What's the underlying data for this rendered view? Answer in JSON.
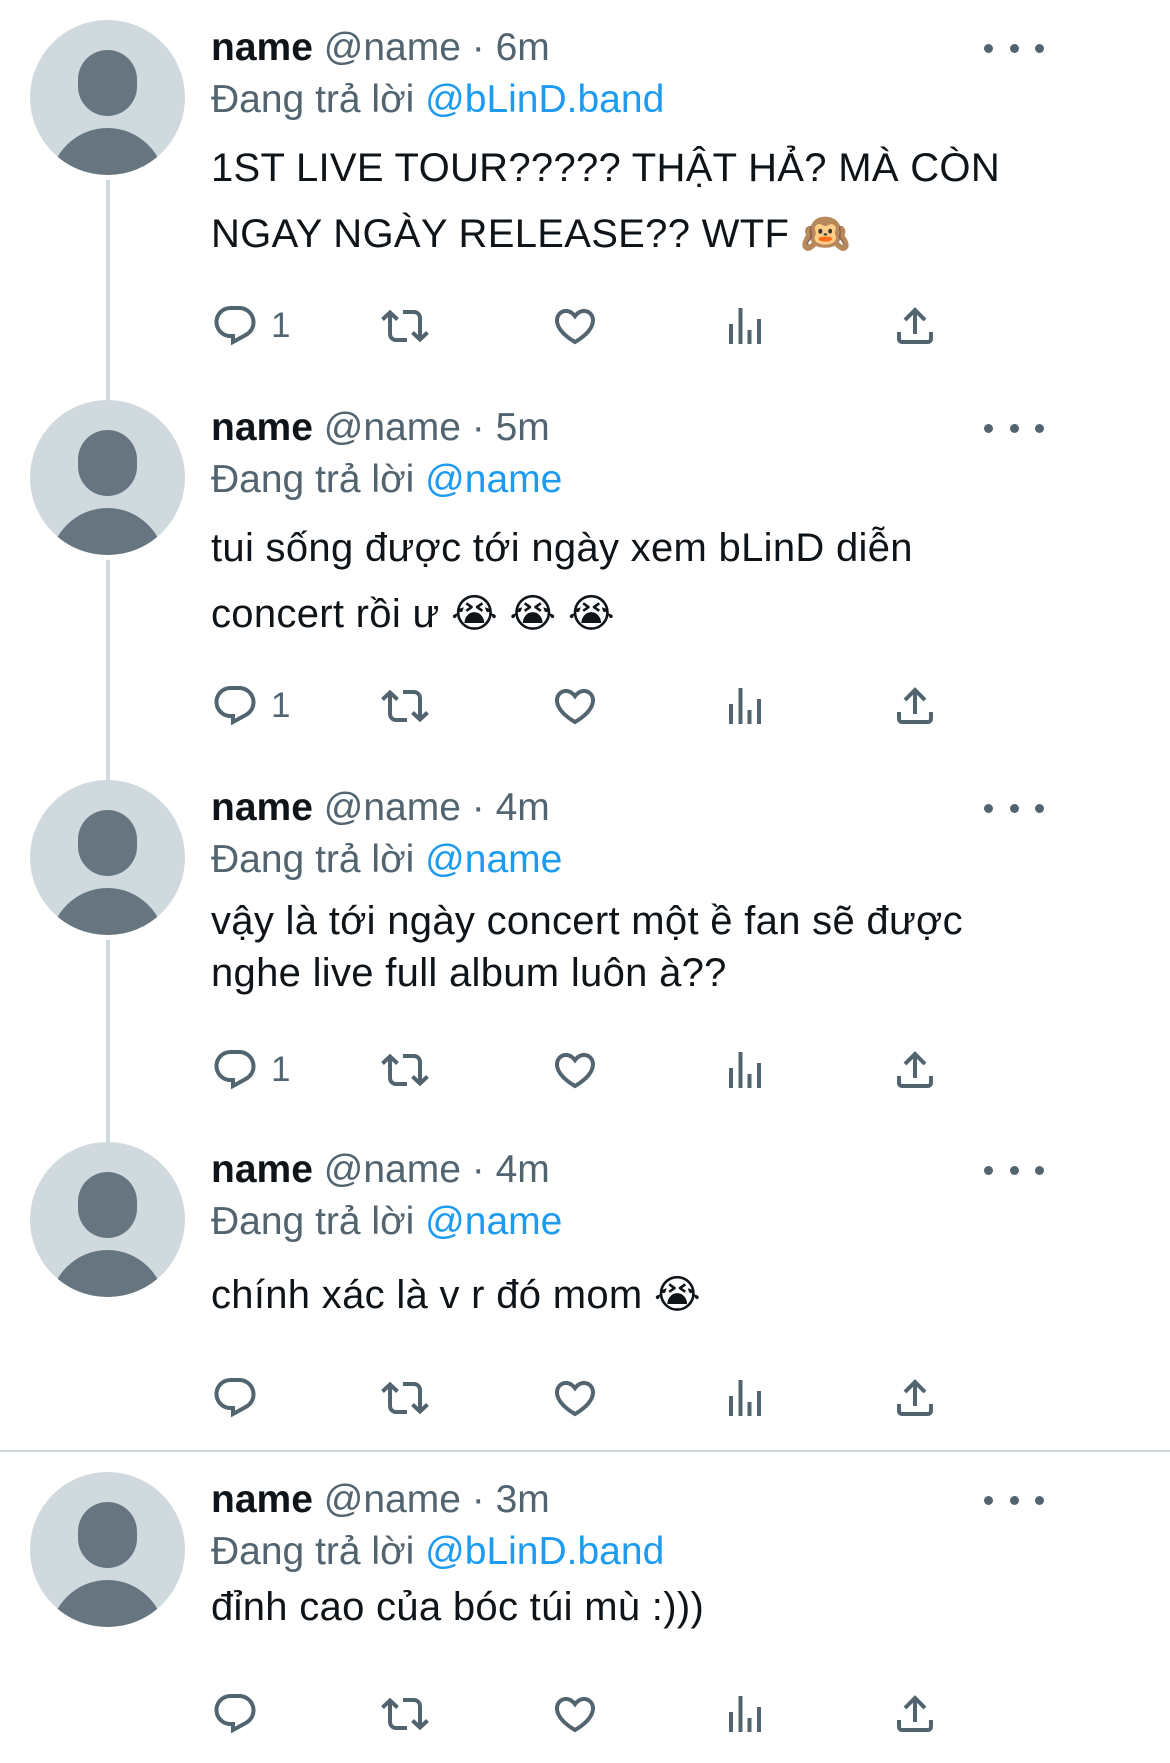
{
  "colors": {
    "accent": "#1d9bf0",
    "secondary_text": "#536471",
    "avatar_bg": "#cfd9de",
    "avatar_fg": "#66757f"
  },
  "tweets": [
    {
      "display_name": "name",
      "handle": "@name",
      "separator": "·",
      "time": "6m",
      "reply_prefix": "Đang trả lời",
      "reply_to": "@bLinD.band",
      "lines": [
        "1ST LIVE TOUR????? THẬT HẢ? MÀ CÒN",
        "NGAY NGÀY RELEASE?? WTF 🙉"
      ],
      "reply_count": "1"
    },
    {
      "display_name": "name",
      "handle": "@name",
      "separator": "·",
      "time": "5m",
      "reply_prefix": "Đang trả lời",
      "reply_to": "@name",
      "lines": [
        "tui sống được tới ngày xem bLinD diễn",
        "concert rồi ư 😭 😭 😭"
      ],
      "reply_count": "1"
    },
    {
      "display_name": "name",
      "handle": "@name",
      "separator": "·",
      "time": "4m",
      "reply_prefix": "Đang trả lời",
      "reply_to": "@name",
      "lines": [
        "vậy là tới ngày concert một ề fan sẽ được",
        "nghe live full album luôn à??"
      ],
      "reply_count": "1"
    },
    {
      "display_name": "name",
      "handle": "@name",
      "separator": "·",
      "time": "4m",
      "reply_prefix": "Đang trả lời",
      "reply_to": "@name",
      "lines": [
        "chính xác là v r đó mom 😭"
      ],
      "reply_count": ""
    },
    {
      "display_name": "name",
      "handle": "@name",
      "separator": "·",
      "time": "3m",
      "reply_prefix": "Đang trả lời",
      "reply_to": "@bLinD.band",
      "lines": [
        "đỉnh cao của bóc túi mù :)))"
      ],
      "reply_count": ""
    }
  ],
  "icons": {
    "reply": "reply-icon",
    "retweet": "retweet-icon",
    "like": "heart-icon",
    "views": "views-icon",
    "share": "share-icon",
    "more": "more-icon"
  }
}
